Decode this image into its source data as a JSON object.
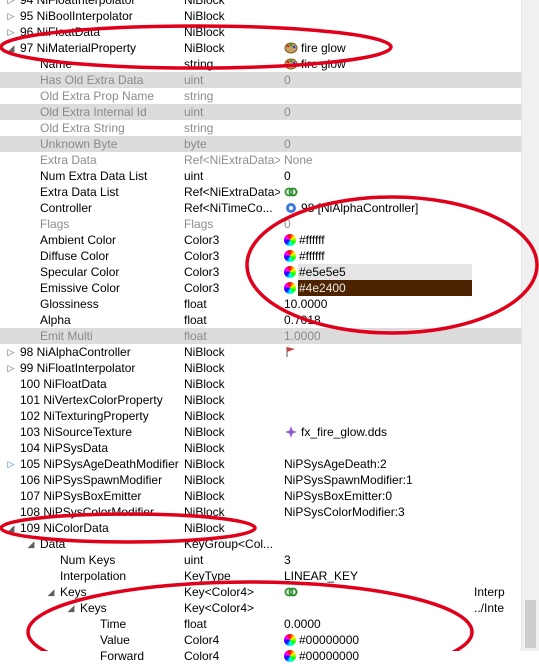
{
  "rows": [
    {
      "indent": 0,
      "arrow": "▷",
      "name": "94 NiFloatInterpolator",
      "type": "NiBlock",
      "value": ""
    },
    {
      "indent": 0,
      "arrow": "▷",
      "name": "95 NiBoolInterpolator",
      "type": "NiBlock",
      "value": ""
    },
    {
      "indent": 0,
      "arrow": "▷",
      "name": "96 NiFloatData",
      "type": "NiBlock",
      "value": ""
    },
    {
      "indent": 0,
      "arrow": "◢",
      "name": "97 NiMaterialProperty",
      "type": "NiBlock",
      "value": "fire glow",
      "icon": "paint-palette-icon"
    },
    {
      "indent": 1,
      "name": "Name",
      "type": "string",
      "value": "fire glow",
      "icon": "paint-palette-icon"
    },
    {
      "indent": 1,
      "name": "Has Old Extra Data",
      "type": "uint",
      "value": "0",
      "style": "gray dim"
    },
    {
      "indent": 1,
      "name": "Old Extra Prop Name",
      "type": "string",
      "value": "",
      "style": "dim"
    },
    {
      "indent": 1,
      "name": "Old Extra Internal Id",
      "type": "uint",
      "value": "0",
      "style": "gray dim"
    },
    {
      "indent": 1,
      "name": "Old Extra String",
      "type": "string",
      "value": "",
      "style": "dim"
    },
    {
      "indent": 1,
      "name": "Unknown Byte",
      "type": "byte",
      "value": "0",
      "style": "gray dim"
    },
    {
      "indent": 1,
      "name": "Extra Data",
      "type": "Ref<NiExtraData>",
      "value": "None",
      "style": "dim"
    },
    {
      "indent": 1,
      "name": "Num Extra Data List",
      "type": "uint",
      "value": "0"
    },
    {
      "indent": 1,
      "name": "Extra Data List",
      "type": "Ref<NiExtraData>",
      "value": "",
      "icon": "link-icon"
    },
    {
      "indent": 1,
      "name": "Controller",
      "type": "Ref<NiTimeCo...",
      "value": "98 [NiAlphaController]",
      "icon": "controller-icon"
    },
    {
      "indent": 1,
      "name": "Flags",
      "type": "Flags",
      "value": "0",
      "style": "dim"
    },
    {
      "indent": 1,
      "name": "Ambient Color",
      "type": "Color3",
      "value": "#ffffff",
      "icon": "color-wheel-icon"
    },
    {
      "indent": 1,
      "name": "Diffuse Color",
      "type": "Color3",
      "value": "#ffffff",
      "icon": "color-wheel-icon"
    },
    {
      "indent": 1,
      "name": "Specular Color",
      "type": "Color3",
      "value": "#e5e5e5",
      "icon": "color-wheel-icon",
      "bar": "#e5e5e5"
    },
    {
      "indent": 1,
      "name": "Emissive Color",
      "type": "Color3",
      "value": "#4e2400",
      "icon": "color-wheel-icon",
      "bar": "#4e2400"
    },
    {
      "indent": 1,
      "name": "Glossiness",
      "type": "float",
      "value": "10.0000"
    },
    {
      "indent": 1,
      "name": "Alpha",
      "type": "float",
      "value": "0.7018"
    },
    {
      "indent": 1,
      "name": "Emit Multi",
      "type": "float",
      "value": "1.0000",
      "style": "gray dim"
    },
    {
      "indent": 0,
      "arrow": "▷",
      "name": "98 NiAlphaController",
      "type": "NiBlock",
      "value": "",
      "icon": "flag-icon"
    },
    {
      "indent": 0,
      "arrow": "▷",
      "name": "99 NiFloatInterpolator",
      "type": "NiBlock",
      "value": ""
    },
    {
      "indent": 0,
      "arrow": "",
      "name": "100 NiFloatData",
      "type": "NiBlock",
      "value": ""
    },
    {
      "indent": 0,
      "arrow": "",
      "name": "101 NiVertexColorProperty",
      "type": "NiBlock",
      "value": ""
    },
    {
      "indent": 0,
      "arrow": "",
      "name": "102 NiTexturingProperty",
      "type": "NiBlock",
      "value": ""
    },
    {
      "indent": 0,
      "arrow": "",
      "name": "103 NiSourceTexture",
      "type": "NiBlock",
      "value": "fx_fire_glow.dds",
      "icon": "texture-icon"
    },
    {
      "indent": 0,
      "arrow": "",
      "name": "104 NiPSysData",
      "type": "NiBlock",
      "value": ""
    },
    {
      "indent": 0,
      "arrow": "▷",
      "arrowBlue": true,
      "name": "105 NiPSysAgeDeathModifier",
      "type": "NiBlock",
      "value": "NiPSysAgeDeath:2"
    },
    {
      "indent": 0,
      "arrow": "",
      "name": "106 NiPSysSpawnModifier",
      "type": "NiBlock",
      "value": "NiPSysSpawnModifier:1"
    },
    {
      "indent": 0,
      "arrow": "",
      "name": "107 NiPSysBoxEmitter",
      "type": "NiBlock",
      "value": "NiPSysBoxEmitter:0"
    },
    {
      "indent": 0,
      "arrow": "",
      "name": "108 NiPSysColorModifier",
      "type": "NiBlock",
      "value": "NiPSysColorModifier:3"
    },
    {
      "indent": 0,
      "arrow": "◢",
      "name": "109 NiColorData",
      "type": "NiBlock",
      "value": ""
    },
    {
      "indent": 1,
      "arrow": "◢",
      "name": "Data",
      "type": "KeyGroup<Col...",
      "value": ""
    },
    {
      "indent": 2,
      "name": "Num Keys",
      "type": "uint",
      "value": "3"
    },
    {
      "indent": 2,
      "name": "Interpolation",
      "type": "KeyType",
      "value": "LINEAR_KEY"
    },
    {
      "indent": 2,
      "arrow": "◢",
      "name": "Keys",
      "type": "Key<Color4>",
      "value": "",
      "icon": "link-icon",
      "extra": "Interp"
    },
    {
      "indent": 3,
      "arrow": "◢",
      "name": "Keys",
      "type": "Key<Color4>",
      "value": "",
      "extra": "../Inte"
    },
    {
      "indent": 4,
      "name": "Time",
      "type": "float",
      "value": "0.0000"
    },
    {
      "indent": 4,
      "name": "Value",
      "type": "Color4",
      "value": "#00000000",
      "icon": "color-wheel-icon"
    },
    {
      "indent": 4,
      "name": "Forward",
      "type": "Color4",
      "value": "#00000000",
      "icon": "color-wheel-icon"
    }
  ]
}
